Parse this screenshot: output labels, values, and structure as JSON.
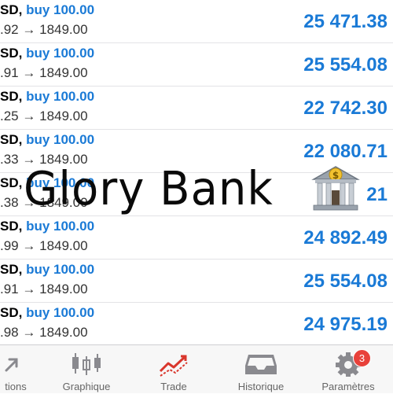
{
  "positions": [
    {
      "symbol": "SD,",
      "side": "buy 100.00",
      "from": ".92",
      "to": "1849.00",
      "profit": "25 471.38"
    },
    {
      "symbol": "SD,",
      "side": "buy 100.00",
      "from": ".91",
      "to": "1849.00",
      "profit": "25 554.08"
    },
    {
      "symbol": "SD,",
      "side": "buy 100.00",
      "from": ".25",
      "to": "1849.00",
      "profit": "22 742.30"
    },
    {
      "symbol": "SD,",
      "side": "buy 100.00",
      "from": ".33",
      "to": "1849.00",
      "profit": "22 080.71"
    },
    {
      "symbol": "SD,",
      "side": "buy 100.00",
      "from": ".38",
      "to": "1849.00",
      "profit": "21 "
    },
    {
      "symbol": "SD,",
      "side": "buy 100.00",
      "from": ".99",
      "to": "1849.00",
      "profit": "24 892.49"
    },
    {
      "symbol": "SD,",
      "side": "buy 100.00",
      "from": ".91",
      "to": "1849.00",
      "profit": "25 554.08"
    },
    {
      "symbol": "SD,",
      "side": "buy 100.00",
      "from": ".98",
      "to": "1849.00",
      "profit": "24 975.19"
    }
  ],
  "arrow": "→",
  "watermark": "Glory Bank",
  "tabs": [
    {
      "label": "tions",
      "icon": "arrow-icon",
      "active": false
    },
    {
      "label": "Graphique",
      "icon": "candlestick-icon",
      "active": false
    },
    {
      "label": "Trade",
      "icon": "trade-chart-icon",
      "active": true
    },
    {
      "label": "Historique",
      "icon": "inbox-icon",
      "active": false
    },
    {
      "label": "Paramètres",
      "icon": "gear-icon",
      "active": false,
      "badge": "3"
    }
  ],
  "colors": {
    "accent": "#1a7ad6",
    "active_tab": "#d9362c",
    "badge": "#e8413a"
  }
}
